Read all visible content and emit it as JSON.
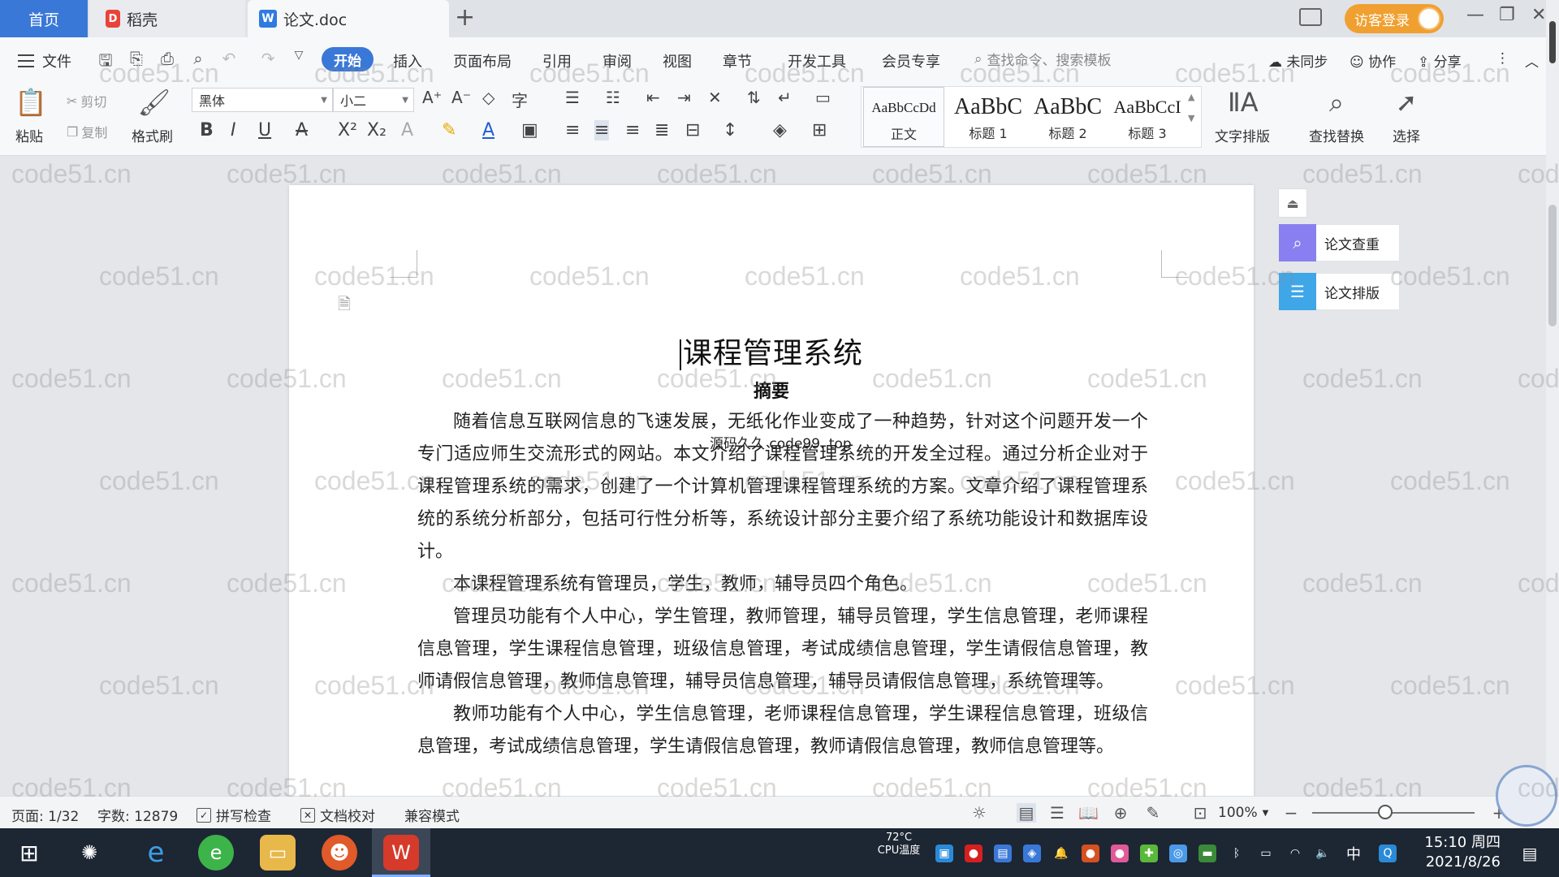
{
  "tabs": {
    "home": "首页",
    "daoke": "稻壳",
    "doc": "论文.doc",
    "login": "访客登录"
  },
  "menu": {
    "file": "文件",
    "items": [
      "开始",
      "插入",
      "页面布局",
      "引用",
      "审阅",
      "视图",
      "章节",
      "开发工具",
      "会员专享"
    ],
    "search_placeholder": "查找命令、搜索模板",
    "sync": "未同步",
    "collab": "协作",
    "share": "分享"
  },
  "ribbon": {
    "paste": "粘贴",
    "cut": "剪切",
    "copy": "复制",
    "format_painter": "格式刷",
    "font_name": "黑体",
    "font_size": "小二",
    "styles": [
      {
        "sample": "AaBbCcDd",
        "label": "正文"
      },
      {
        "sample": "AaBbC",
        "label": "标题 1"
      },
      {
        "sample": "AaBbC",
        "label": "标题 2"
      },
      {
        "sample": "AaBbCcI",
        "label": "标题 3"
      }
    ],
    "text_layout": "文字排版",
    "find_replace": "查找替换",
    "select": "选择"
  },
  "side_panel": {
    "check": "论文查重",
    "layout": "论文排版"
  },
  "document": {
    "title": "课程管理系统",
    "abstract_heading": "摘要",
    "overlay": "源码久久 code99. top",
    "paragraphs": [
      "随着信息互联网信息的飞速发展，无纸化作业变成了一种趋势，针对这个问题开发一个专门适应师生交流形式的网站。本文介绍了课程管理系统的开发全过程。通过分析企业对于课程管理系统的需求，创建了一个计算机管理课程管理系统的方案。文章介绍了课程管理系统的系统分析部分，包括可行性分析等，系统设计部分主要介绍了系统功能设计和数据库设计。",
      "本课程管理系统有管理员，学生，教师，辅导员四个角色。",
      "管理员功能有个人中心，学生管理，教师管理，辅导员管理，学生信息管理，老师课程信息管理，学生课程信息管理，班级信息管理，考试成绩信息管理，学生请假信息管理，教师请假信息管理，教师信息管理，辅导员信息管理，辅导员请假信息管理，系统管理等。",
      "教师功能有个人中心，学生信息管理，老师课程信息管理，学生课程信息管理，班级信息管理，考试成绩信息管理，学生请假信息管理，教师请假信息管理，教师信息管理等。"
    ]
  },
  "status": {
    "page": "页面: 1/32",
    "words": "字数: 12879",
    "spell": "拼写检查",
    "proof": "文档校对",
    "compat": "兼容模式",
    "zoom": "100%",
    "zoom_fraction": 0.45
  },
  "taskbar": {
    "temp": "72°C",
    "temp_label": "CPU温度",
    "ime": "中",
    "time": "15:10 周四",
    "date": "2021/8/26"
  },
  "watermark": "code51.cn",
  "colors": {
    "accent": "#3a78d8",
    "login": "#f0a030",
    "taskbar": "#1d2633"
  }
}
